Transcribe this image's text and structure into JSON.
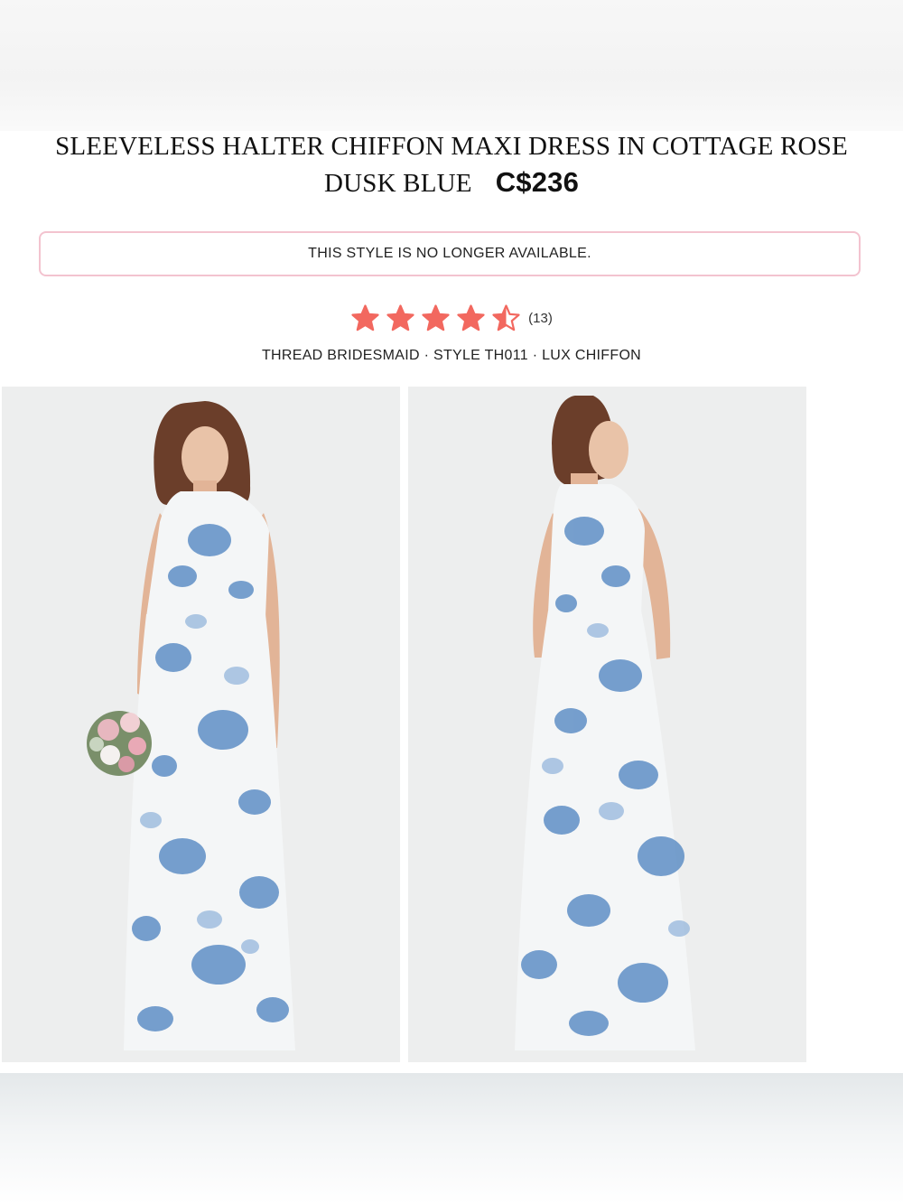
{
  "product": {
    "title_line1": "SLEEVELESS HALTER CHIFFON MAXI DRESS IN COTTAGE ROSE",
    "title_line2": "DUSK BLUE",
    "price": "C$236"
  },
  "availability": {
    "notice": "THIS STYLE IS NO LONGER AVAILABLE."
  },
  "rating": {
    "value": 4.5,
    "max": 5,
    "review_count": "(13)",
    "star_color": "#f2685f"
  },
  "meta": {
    "line": "THREAD BRIDESMAID · STYLE TH011 · LUX CHIFFON"
  },
  "images": [
    {
      "view": "front",
      "alt": ""
    },
    {
      "view": "back",
      "alt": ""
    }
  ],
  "colors": {
    "notice_border": "#f3c3cf",
    "dress_print": "#5f8fc6",
    "dress_base": "#f4f6f7"
  }
}
